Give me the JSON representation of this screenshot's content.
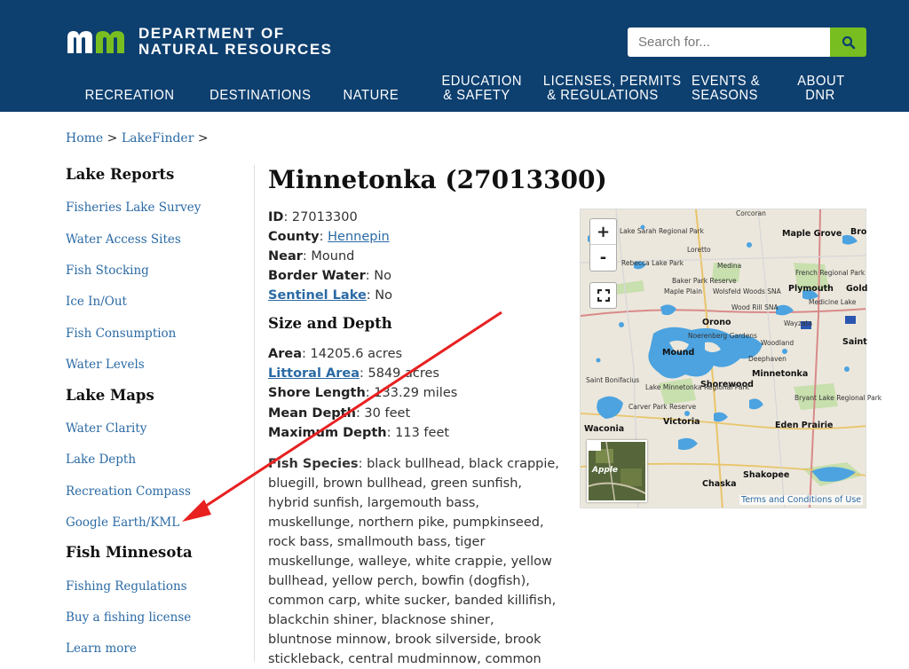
{
  "header": {
    "logo_line1": "DEPARTMENT OF",
    "logo_line2": "NATURAL RESOURCES",
    "search_placeholder": "Search for...",
    "search_icon": "magnifier-icon",
    "nav": [
      {
        "line1": "RECREATION",
        "line2": ""
      },
      {
        "line1": "DESTINATIONS",
        "line2": ""
      },
      {
        "line1": "NATURE",
        "line2": ""
      },
      {
        "line1": "EDUCATION",
        "line2": "& SAFETY"
      },
      {
        "line1": "LICENSES, PERMITS",
        "line2": "& REGULATIONS"
      },
      {
        "line1": "EVENTS &",
        "line2": "SEASONS"
      },
      {
        "line1": "ABOUT",
        "line2": "DNR"
      }
    ]
  },
  "breadcrumb": {
    "home": "Home",
    "sep1": ">",
    "lakefinder": "LakeFinder",
    "sep2": ">"
  },
  "sidebar": {
    "lake_reports_heading": "Lake Reports",
    "lake_reports": [
      "Fisheries Lake Survey",
      "Water Access Sites",
      "Fish Stocking",
      "Ice In/Out",
      "Fish Consumption",
      "Water Levels"
    ],
    "lake_maps_heading": "Lake Maps",
    "lake_maps": [
      "Water Clarity",
      "Lake Depth",
      "Recreation Compass",
      "Google Earth/KML"
    ],
    "fish_mn_heading": "Fish Minnesota",
    "fish_mn": [
      "Fishing Regulations",
      "Buy a fishing license",
      "Learn more"
    ]
  },
  "lake": {
    "title": "Minnetonka (27013300)",
    "id_label": "ID",
    "id_value": ": 27013300",
    "county_label": "County",
    "county_sep": ": ",
    "county_value": "Hennepin",
    "near_label": "Near",
    "near_value": ": Mound",
    "border_label": "Border Water",
    "border_value": ": No",
    "sentinel_label": "Sentinel Lake",
    "sentinel_value": ": No",
    "size_heading": "Size and Depth",
    "area_label": "Area",
    "area_value": ": 14205.6 acres",
    "littoral_label": "Littoral Area",
    "littoral_value": ": 5849 acres",
    "shore_label": "Shore Length",
    "shore_value": ": 133.29 miles",
    "mean_label": "Mean Depth",
    "mean_value": ": 30 feet",
    "max_label": "Maximum Depth",
    "max_value": ": 113 feet",
    "species_label": "Fish Species",
    "species_value": ": black bullhead, black crappie, bluegill, brown bullhead, green sunfish, hybrid sunfish, largemouth bass, muskellunge, northern pike, pumpkinseed, rock bass, smallmouth bass, tiger muskellunge, walleye, white crappie, yellow bullhead, yellow perch, bowfin (dogfish), common carp, white sucker, banded killifish, blackchin shiner, blacknose shiner, bluntnose minnow, brook silverside, brook stickleback, central mudminnow, common"
  },
  "map": {
    "zoom_in": "+",
    "zoom_out": "-",
    "fullscreen_icon": "fullscreen-icon",
    "aerial_label": "Apple",
    "terms": "Terms and Conditions of Use",
    "labels": [
      {
        "t": "Corcoran",
        "big": false
      },
      {
        "t": "Maple Grove",
        "big": true
      },
      {
        "t": "Lake Sarah Regional Park",
        "big": false
      },
      {
        "t": "Loretto",
        "big": false
      },
      {
        "t": "Medina",
        "big": false
      },
      {
        "t": "Rebecca Lake Park",
        "big": false
      },
      {
        "t": "Baker Park Reserve",
        "big": false
      },
      {
        "t": "Maple Plain",
        "big": false
      },
      {
        "t": "Wolsfeld Woods SNA",
        "big": false
      },
      {
        "t": "Plymouth",
        "big": true
      },
      {
        "t": "French Regional Park",
        "big": false
      },
      {
        "t": "Orono",
        "big": true
      },
      {
        "t": "Medicine Lake",
        "big": false
      },
      {
        "t": "Wood Rill SNA",
        "big": false
      },
      {
        "t": "Woodland",
        "big": false
      },
      {
        "t": "Mound",
        "big": true
      },
      {
        "t": "Noerenberg Gardens",
        "big": false
      },
      {
        "t": "Deephaven",
        "big": false
      },
      {
        "t": "Minnetonka",
        "big": true
      },
      {
        "t": "Shorewood",
        "big": true
      },
      {
        "t": "Wayzata",
        "big": false
      },
      {
        "t": "Saint Bonifacius",
        "big": false
      },
      {
        "t": "Lake Minnetonka Regional Park",
        "big": false
      },
      {
        "t": "Carver Park Reserve",
        "big": false
      },
      {
        "t": "Victoria",
        "big": true
      },
      {
        "t": "Waconia",
        "big": true
      },
      {
        "t": "Eden Prairie",
        "big": true
      },
      {
        "t": "Chaska",
        "big": true
      },
      {
        "t": "Shakopee",
        "big": true
      },
      {
        "t": "Bryant Lake Regional Park",
        "big": false
      },
      {
        "t": "Saint",
        "big": true
      },
      {
        "t": "Gold",
        "big": true
      },
      {
        "t": "Bro",
        "big": true
      }
    ]
  }
}
